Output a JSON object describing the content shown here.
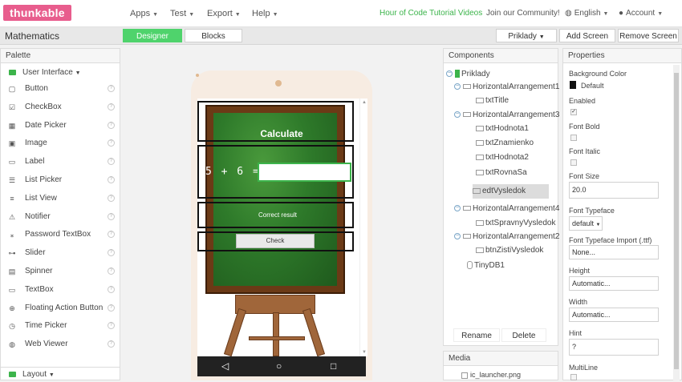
{
  "brand": "thunkable",
  "nav": {
    "apps": "Apps",
    "test": "Test",
    "export": "Export",
    "help": "Help",
    "tutorial": "Hour of Code Tutorial Videos",
    "community": "Join our Community!",
    "language": "English",
    "account": "Account"
  },
  "project": {
    "title": "Mathematics",
    "designer": "Designer",
    "blocks": "Blocks",
    "screen": "Priklady",
    "add_screen": "Add Screen",
    "remove_screen": "Remove Screen"
  },
  "palette": {
    "header": "Palette",
    "group": "User Interface",
    "items": [
      {
        "label": "Button",
        "icon": "button-icon",
        "glyph": "▢"
      },
      {
        "label": "CheckBox",
        "icon": "checkbox-icon",
        "glyph": "☑"
      },
      {
        "label": "Date Picker",
        "icon": "calendar-icon",
        "glyph": "▦"
      },
      {
        "label": "Image",
        "icon": "image-icon",
        "glyph": "▣"
      },
      {
        "label": "Label",
        "icon": "label-icon",
        "glyph": "▭"
      },
      {
        "label": "List Picker",
        "icon": "list-picker-icon",
        "glyph": "☰"
      },
      {
        "label": "List View",
        "icon": "list-view-icon",
        "glyph": "≡"
      },
      {
        "label": "Notifier",
        "icon": "warning-icon",
        "glyph": "⚠"
      },
      {
        "label": "Password TextBox",
        "icon": "password-icon",
        "glyph": "⁎"
      },
      {
        "label": "Slider",
        "icon": "slider-icon",
        "glyph": "⊶"
      },
      {
        "label": "Spinner",
        "icon": "spinner-icon",
        "glyph": "▤"
      },
      {
        "label": "TextBox",
        "icon": "textbox-icon",
        "glyph": "▭"
      },
      {
        "label": "Floating Action Button",
        "icon": "plus-circle-icon",
        "glyph": "⊕"
      },
      {
        "label": "Time Picker",
        "icon": "clock-icon",
        "glyph": "◷"
      },
      {
        "label": "Web Viewer",
        "icon": "globe-icon",
        "glyph": "◍"
      }
    ],
    "layout_group": "Layout"
  },
  "viewer": {
    "calc_title": "Calculate",
    "equation": "5 + 6 =",
    "answer_value": "",
    "result_text": "Correct result",
    "check_label": "Check"
  },
  "components": {
    "header": "Components",
    "root": "Priklady",
    "items": [
      {
        "name": "HorizontalArrangement1"
      },
      {
        "name": "txtTitle"
      },
      {
        "name": "HorizontalArrangement3"
      },
      {
        "name": "txtHodnota1"
      },
      {
        "name": "txtZnamienko"
      },
      {
        "name": "txtHodnota2"
      },
      {
        "name": "txtRovnaSa"
      },
      {
        "name": "edtVysledok"
      },
      {
        "name": "HorizontalArrangement4"
      },
      {
        "name": "txtSpravnyVysledok"
      },
      {
        "name": "HorizontalArrangement2"
      },
      {
        "name": "btnZistiVysledok"
      },
      {
        "name": "TinyDB1"
      }
    ],
    "rename": "Rename",
    "delete": "Delete",
    "media_header": "Media",
    "media_file": "ic_launcher.png"
  },
  "properties": {
    "header": "Properties",
    "background_color_label": "Background Color",
    "background_color_value": "Default",
    "enabled_label": "Enabled",
    "font_bold_label": "Font Bold",
    "font_italic_label": "Font Italic",
    "font_size_label": "Font Size",
    "font_size_value": "20.0",
    "font_typeface_label": "Font Typeface",
    "font_typeface_value": "default",
    "font_typeface_import_label": "Font Typeface Import (.ttf)",
    "font_typeface_import_value": "None...",
    "height_label": "Height",
    "height_value": "Automatic...",
    "width_label": "Width",
    "width_value": "Automatic...",
    "hint_label": "Hint",
    "hint_value": "?",
    "multiline_label": "MultiLine",
    "enabled_checked": true,
    "font_bold_checked": false,
    "font_italic_checked": false
  },
  "colors": {
    "brand": "#e85d8d",
    "accent_green": "#4fd36c",
    "board": "#2e7a2a",
    "frame": "#6b3a16"
  }
}
